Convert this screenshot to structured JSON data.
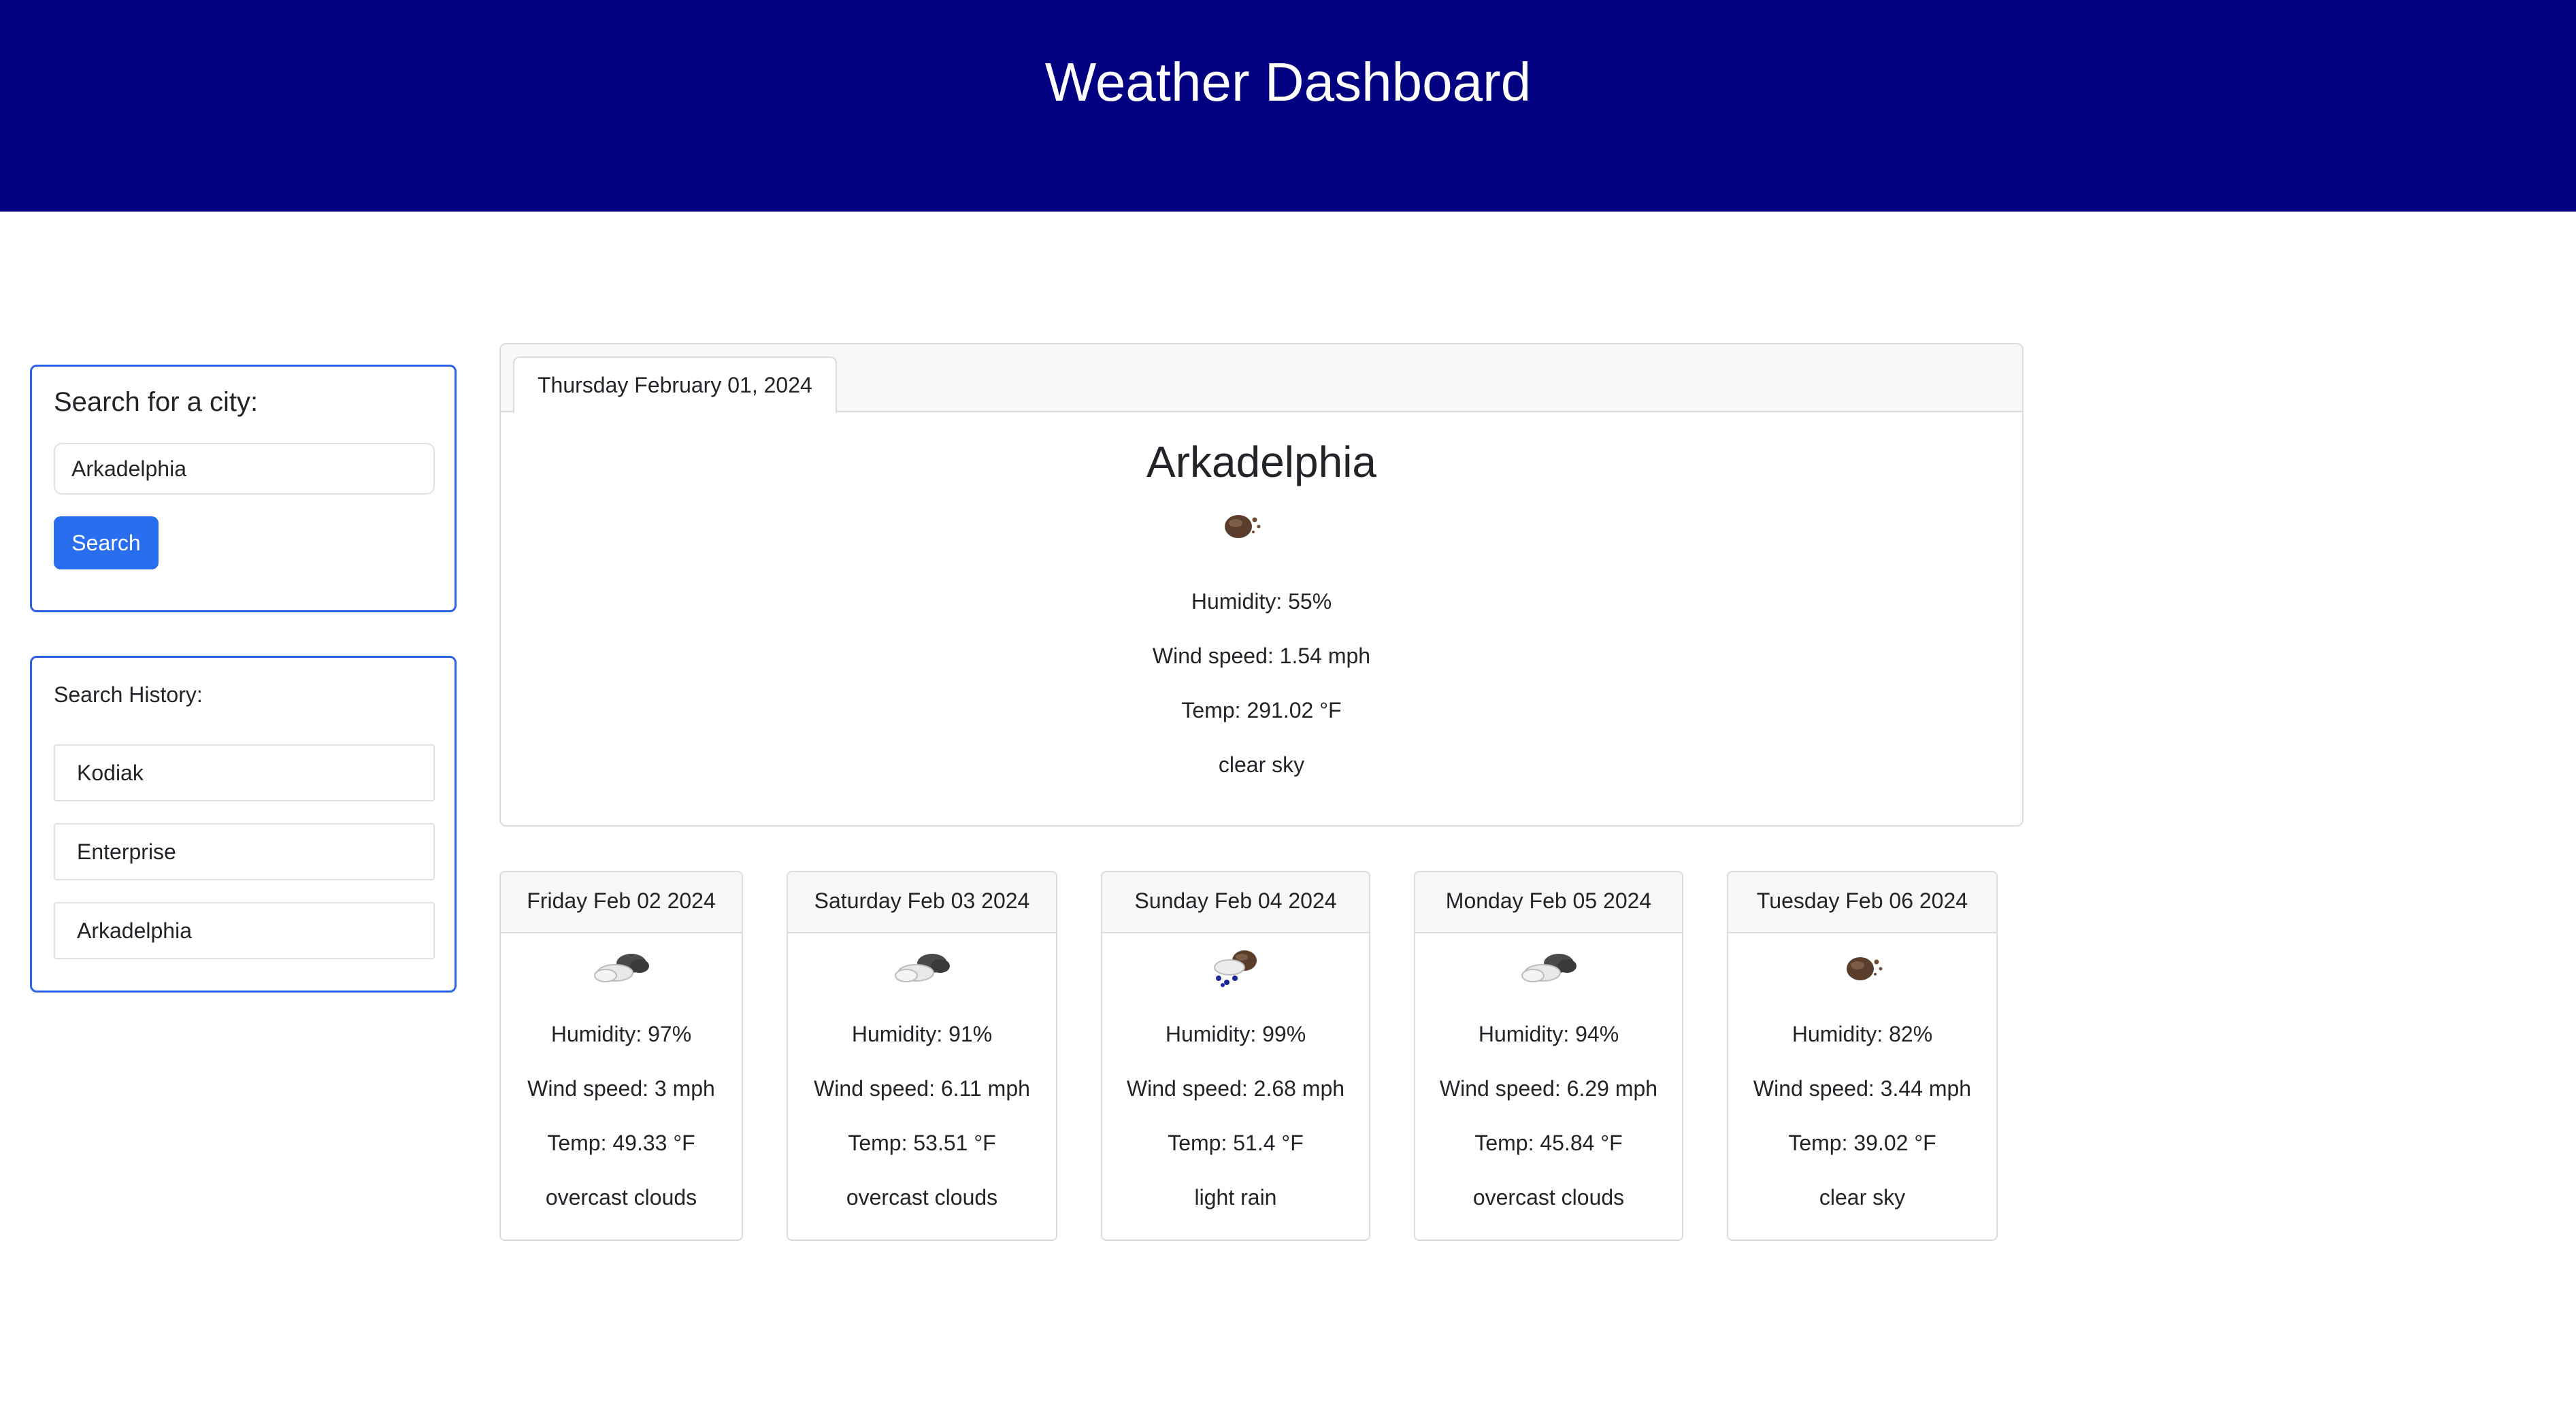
{
  "header": {
    "title": "Weather Dashboard"
  },
  "search": {
    "title": "Search for a city:",
    "input_value": "Arkadelphia",
    "button_label": "Search"
  },
  "history": {
    "title": "Search History:",
    "items": [
      "Kodiak",
      "Enterprise",
      "Arkadelphia"
    ]
  },
  "today": {
    "date": "Thursday February 01, 2024",
    "city": "Arkadelphia",
    "icon": "clear-sky-icon",
    "humidity": "Humidity: 55%",
    "wind": "Wind speed: 1.54 mph",
    "temp": "Temp: 291.02 °F",
    "description": "clear sky"
  },
  "forecast": [
    {
      "date": "Friday Feb 02 2024",
      "icon": "overcast-clouds-icon",
      "humidity": "Humidity: 97%",
      "wind": "Wind speed: 3 mph",
      "temp": "Temp: 49.33 °F",
      "description": "overcast clouds"
    },
    {
      "date": "Saturday Feb 03 2024",
      "icon": "overcast-clouds-icon",
      "humidity": "Humidity: 91%",
      "wind": "Wind speed: 6.11 mph",
      "temp": "Temp: 53.51 °F",
      "description": "overcast clouds"
    },
    {
      "date": "Sunday Feb 04 2024",
      "icon": "light-rain-icon",
      "humidity": "Humidity: 99%",
      "wind": "Wind speed: 2.68 mph",
      "temp": "Temp: 51.4 °F",
      "description": "light rain"
    },
    {
      "date": "Monday Feb 05 2024",
      "icon": "overcast-clouds-icon",
      "humidity": "Humidity: 94%",
      "wind": "Wind speed: 6.29 mph",
      "temp": "Temp: 45.84 °F",
      "description": "overcast clouds"
    },
    {
      "date": "Tuesday Feb 06 2024",
      "icon": "clear-sky-icon",
      "humidity": "Humidity: 82%",
      "wind": "Wind speed: 3.44 mph",
      "temp": "Temp: 39.02 °F",
      "description": "clear sky"
    }
  ],
  "colors": {
    "header_bg": "#000080",
    "accent": "#2a6ef0",
    "panel_border": "#2a62e8"
  }
}
